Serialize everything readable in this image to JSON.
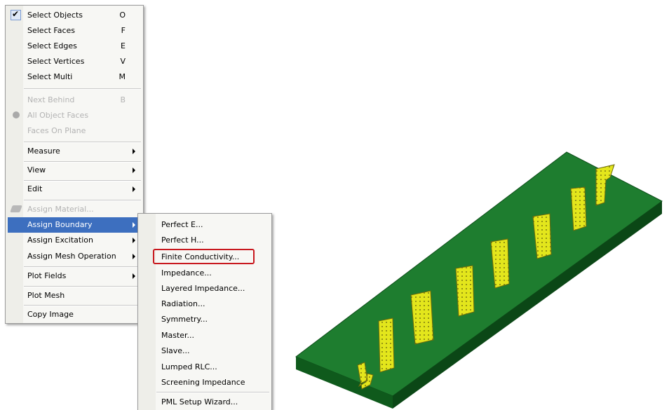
{
  "main_menu": {
    "items": [
      {
        "label": "Select Objects",
        "key": "O"
      },
      {
        "label": "Select Faces",
        "key": "F"
      },
      {
        "label": "Select Edges",
        "key": "E"
      },
      {
        "label": "Select Vertices",
        "key": "V"
      },
      {
        "label": "Select Multi",
        "key": "M"
      },
      {
        "label": "Next Behind",
        "key": "B"
      },
      {
        "label": "All Object Faces"
      },
      {
        "label": "Faces On Plane"
      },
      {
        "label": "Measure"
      },
      {
        "label": "View"
      },
      {
        "label": "Edit"
      },
      {
        "label": "Assign Material..."
      },
      {
        "label": "Assign Boundary"
      },
      {
        "label": "Assign Excitation"
      },
      {
        "label": "Assign Mesh Operation"
      },
      {
        "label": "Plot Fields"
      },
      {
        "label": "Plot Mesh"
      },
      {
        "label": "Copy Image"
      }
    ]
  },
  "sub_menu": {
    "items": [
      {
        "label": "Perfect E..."
      },
      {
        "label": "Perfect H..."
      },
      {
        "label": "Finite Conductivity..."
      },
      {
        "label": "Impedance..."
      },
      {
        "label": "Layered Impedance..."
      },
      {
        "label": "Radiation..."
      },
      {
        "label": "Symmetry..."
      },
      {
        "label": "Master..."
      },
      {
        "label": "Slave..."
      },
      {
        "label": "Lumped RLC..."
      },
      {
        "label": "Screening Impedance"
      },
      {
        "label": "PML Setup Wizard..."
      }
    ]
  },
  "colors": {
    "highlight": "#3d6fbf",
    "board_top": "#1e7d2f",
    "patch": "#e3e61c",
    "callout": "#c8181e"
  },
  "icons": [
    "checkmark-icon",
    "submenu-arrow-icon",
    "face-icon",
    "material-icon"
  ]
}
